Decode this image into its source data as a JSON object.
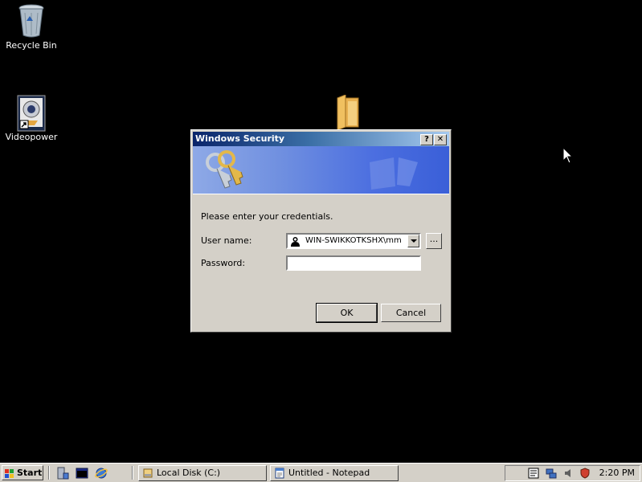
{
  "desktop": {
    "icons": [
      {
        "label": "Recycle Bin",
        "icon": "recycle-bin-icon"
      },
      {
        "label": "Videopower",
        "icon": "webcam-shortcut-icon"
      }
    ]
  },
  "dialog": {
    "title": "Windows Security",
    "help_label": "?",
    "close_label": "✕",
    "message": "Please enter your credentials.",
    "username_label": "User name:",
    "username_value": "WIN-SWIKKOTKSHX\\mm",
    "browse_label": "...",
    "password_label": "Password:",
    "password_value": "",
    "ok_label": "OK",
    "cancel_label": "Cancel"
  },
  "taskbar": {
    "start_label": "Start",
    "tasks": [
      {
        "label": "Local Disk (C:)",
        "icon": "drive-icon"
      },
      {
        "label": "Untitled - Notepad",
        "icon": "notepad-icon"
      }
    ],
    "clock": "2:20 PM"
  },
  "colors": {
    "desktop": "#000000",
    "title_gradient_start": "#0a246a",
    "banner_blue": "#4c6fe0",
    "face": "#d4d0c8"
  }
}
